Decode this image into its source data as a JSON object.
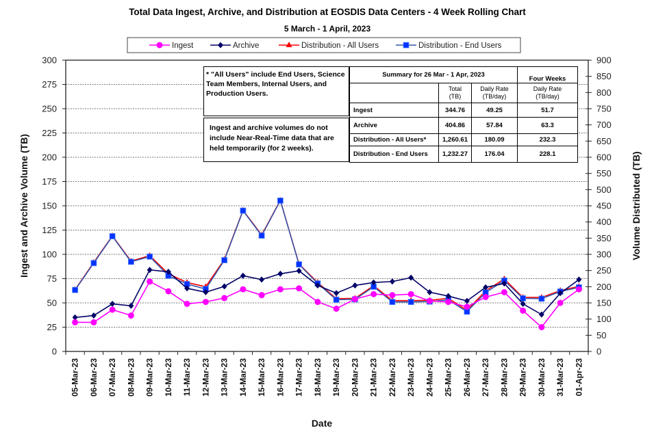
{
  "chart_data": {
    "type": "line",
    "title": "Total Data Ingest, Archive, and  Distribution at EOSDIS Data Centers - 4 Week Rolling Chart",
    "subtitle": "5 March  - 1 April, 2023",
    "xlabel": "Date",
    "ylabel": "Ingest and Archive Volume (TB)",
    "y2label": "Volume Distributed (TB)",
    "ylim": [
      0,
      300
    ],
    "y_ticks": [
      0,
      25,
      50,
      75,
      100,
      125,
      150,
      175,
      200,
      225,
      250,
      275,
      300
    ],
    "y2lim": [
      0,
      900
    ],
    "y2_ticks": [
      0,
      50,
      100,
      150,
      200,
      250,
      300,
      350,
      400,
      450,
      500,
      550,
      600,
      650,
      700,
      750,
      800,
      850,
      900
    ],
    "grid": true,
    "legend_position": "top-center",
    "categories": [
      "05-Mar-23",
      "06-Mar-23",
      "07-Mar-23",
      "08-Mar-23",
      "09-Mar-23",
      "10-Mar-23",
      "11-Mar-23",
      "12-Mar-23",
      "13-Mar-23",
      "14-Mar-23",
      "15-Mar-23",
      "16-Mar-23",
      "17-Mar-23",
      "18-Mar-23",
      "19-Mar-23",
      "20-Mar-23",
      "21-Mar-23",
      "22-Mar-23",
      "23-Mar-23",
      "24-Mar-23",
      "25-Mar-23",
      "26-Mar-23",
      "27-Mar-23",
      "28-Mar-23",
      "29-Mar-23",
      "30-Mar-23",
      "31-Mar-23",
      "01-Apr-23"
    ],
    "series": [
      {
        "name": "Ingest",
        "axis": "left",
        "color": "#ff00ff",
        "marker": "circle",
        "values": [
          30,
          30,
          43,
          37,
          72,
          62,
          49,
          51,
          55,
          64,
          58,
          64,
          65,
          51,
          44,
          54,
          59,
          58,
          59,
          52,
          51,
          46,
          56,
          61,
          42,
          25,
          50,
          64
        ]
      },
      {
        "name": "Archive",
        "axis": "left",
        "color": "#000066",
        "marker": "diamond",
        "values": [
          35,
          37,
          49,
          47,
          84,
          82,
          65,
          61,
          67,
          78,
          74,
          80,
          83,
          68,
          60,
          68,
          71,
          72,
          76,
          61,
          57,
          52,
          66,
          70,
          49,
          38,
          60,
          74
        ]
      },
      {
        "name": "Distribution - All Users",
        "axis": "right",
        "color": "#ff0000",
        "marker": "triangle",
        "values": [
          191,
          275,
          357,
          279,
          296,
          240,
          213,
          200,
          284,
          436,
          360,
          467,
          270,
          213,
          163,
          164,
          203,
          157,
          157,
          158,
          164,
          127,
          187,
          224,
          167,
          167,
          188,
          201
        ]
      },
      {
        "name": "Distribution - End Users",
        "axis": "right",
        "color": "#0033ff",
        "marker": "square",
        "values": [
          190,
          273,
          356,
          277,
          293,
          234,
          208,
          193,
          282,
          435,
          358,
          466,
          269,
          210,
          160,
          161,
          200,
          153,
          153,
          154,
          159,
          123,
          182,
          219,
          164,
          163,
          185,
          198
        ]
      }
    ]
  },
  "notes": {
    "all_users_note": "* \"All Users\" include End Users, Science Team Members,  Internal Users, and Production Users.",
    "nrt_note": "Ingest and archive volumes do not include Near-Real-Time data that are held temporarily (for 2 weeks)."
  },
  "summary": {
    "title": "Summary for 26 Mar  - 1 Apr, 2023",
    "four_weeks_label": "Four Weeks",
    "col_total": "Total",
    "col_total_unit": "(TB)",
    "col_daily": "Daily Rate",
    "col_daily_unit": "(TB/day)",
    "col_four_daily": "Daily Rate",
    "col_four_daily_unit": "(TB/day)",
    "rows": [
      {
        "label": "Ingest",
        "total": "344.76",
        "daily": "49.25",
        "four_weeks": "51.7"
      },
      {
        "label": "Archive",
        "total": "404.86",
        "daily": "57.84",
        "four_weeks": "63.3"
      },
      {
        "label": "Distribution - All Users*",
        "total": "1,260.61",
        "daily": "180.09",
        "four_weeks": "232.3"
      },
      {
        "label": "Distribution - End Users",
        "total": "1,232.27",
        "daily": "176.04",
        "four_weeks": "228.1"
      }
    ]
  }
}
